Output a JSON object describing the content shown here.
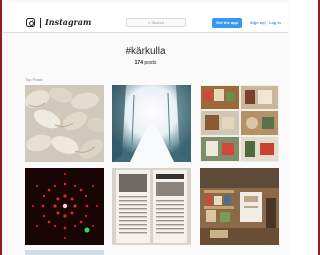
{
  "topbar": {
    "logo_text": "Instagram",
    "search_placeholder": "Search",
    "get_app_label": "Get the app",
    "signup_label": "Sign up",
    "separator": "|",
    "login_label": "Log in"
  },
  "hashtag": {
    "title": "#kärkulla",
    "post_count": "174",
    "post_count_suffix": "posts"
  },
  "section": {
    "label": "Top Posts"
  },
  "posts": [
    {
      "subject": "dumplings on flour"
    },
    {
      "subject": "snowy forest path"
    },
    {
      "subject": "shelves with crafts"
    },
    {
      "subject": "red light pattern"
    },
    {
      "subject": "newspaper pages"
    },
    {
      "subject": "room with shelves"
    }
  ],
  "colors": {
    "accent": "#3897f0",
    "border": "#8f1f1f"
  }
}
